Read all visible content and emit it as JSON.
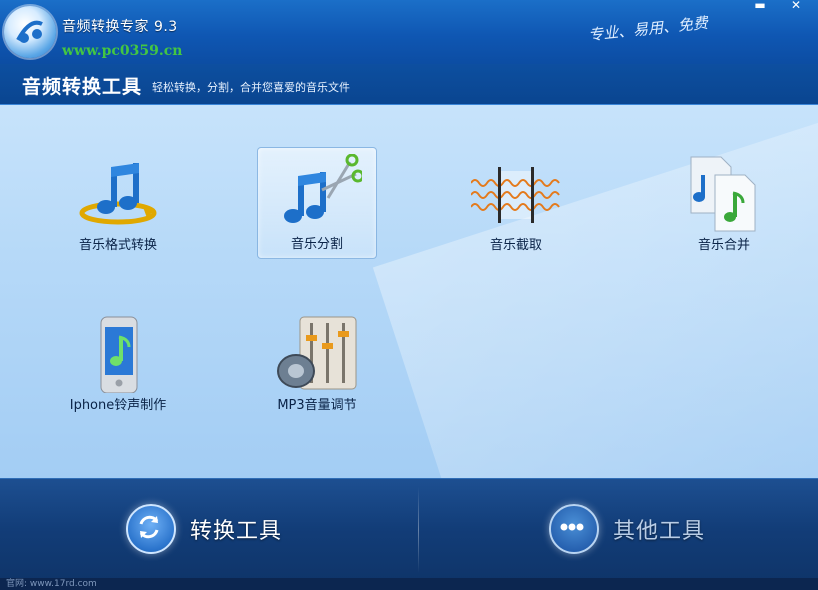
{
  "window": {
    "title": "音频转换专家 9.3",
    "watermark": "www.pc0359.cn",
    "slogan": "专业、易用、免费",
    "minimize_glyph": "▬",
    "close_glyph": "✕"
  },
  "header": {
    "title": "音频转换工具",
    "subtitle": "轻松转换，分割，合并您喜爱的音乐文件"
  },
  "tools": [
    {
      "label": "音乐格式转换",
      "icon": "music-convert-icon",
      "selected": false
    },
    {
      "label": "音乐分割",
      "icon": "music-split-icon",
      "selected": true
    },
    {
      "label": "音乐截取",
      "icon": "music-clip-icon",
      "selected": false
    },
    {
      "label": "音乐合并",
      "icon": "music-merge-icon",
      "selected": false
    },
    {
      "label": "Iphone铃声制作",
      "icon": "iphone-ringtone-icon",
      "selected": false
    },
    {
      "label": "MP3音量调节",
      "icon": "volume-adjust-icon",
      "selected": false
    }
  ],
  "bottom_nav": {
    "convert_tools_label": "转换工具",
    "other_tools_label": "其他工具"
  },
  "footer": {
    "text": "官网: www.17rd.com"
  },
  "colors": {
    "accent": "#0f57b3",
    "main_bg": "#b6d9f8",
    "watermark": "#43c643"
  }
}
